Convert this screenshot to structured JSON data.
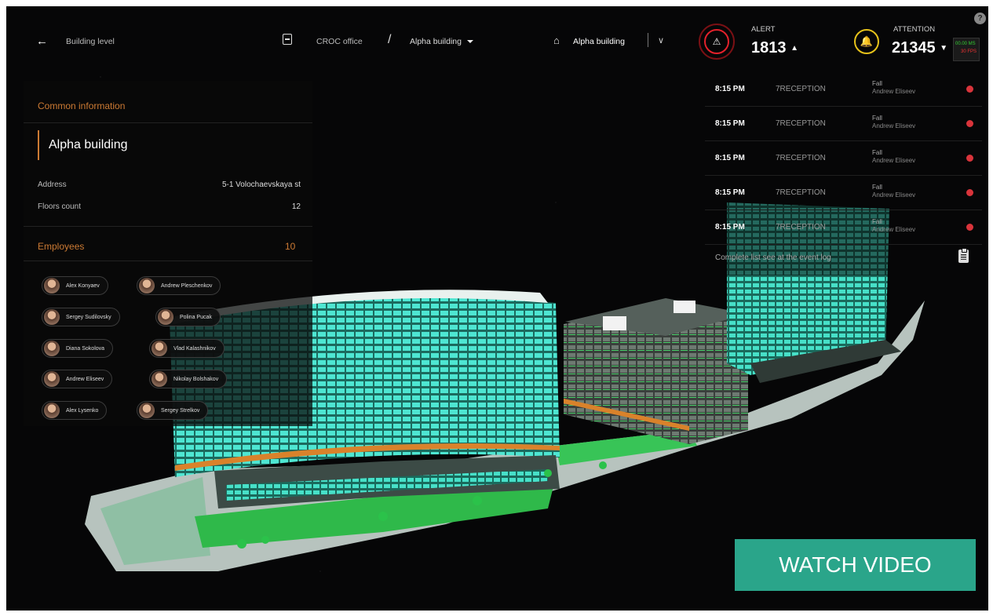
{
  "topbar": {
    "back_label": "Building level",
    "breadcrumb_root": "CROC office",
    "breadcrumb_separator": "/",
    "breadcrumb_current": "Alpha building",
    "building_selector": "Alpha building"
  },
  "counters": {
    "alert_label": "ALERT",
    "alert_value": "1813",
    "attention_label": "ATTENTION",
    "attention_value": "21345",
    "help_label": "?",
    "fps_line1": "00.00 MS",
    "fps_line2": "30 FPS"
  },
  "panel": {
    "section_common": "Common information",
    "building_name": "Alpha building",
    "address_label": "Address",
    "address_value": "5-1 Volochaevskaya st",
    "floors_label": "Floors count",
    "floors_value": "12",
    "employees_label": "Employees",
    "employees_count": "10",
    "employees": [
      "Alex Konyaev",
      "Andrew Pleschenkov",
      "Sergey Sudilovsky",
      "Polina Pucak",
      "Diana Sokolova",
      "Vlad Kalashnikov",
      "Andrew Eliseev",
      "Nikolay Bolshakov",
      "Alex Lysenko",
      "Sergey Strelkov"
    ]
  },
  "events": [
    {
      "time": "8:15 PM",
      "location": "7RECEPTION",
      "type": "Fall",
      "person": "Andrew Eliseev"
    },
    {
      "time": "8:15 PM",
      "location": "7RECEPTION",
      "type": "Fall",
      "person": "Andrew Eliseev"
    },
    {
      "time": "8:15 PM",
      "location": "7RECEPTION",
      "type": "Fall",
      "person": "Andrew Eliseev"
    },
    {
      "time": "8:15 PM",
      "location": "7RECEPTION",
      "type": "Fall",
      "person": "Andrew Eliseev"
    },
    {
      "time": "8:15 PM",
      "location": "7RECEPTION",
      "type": "Fall",
      "person": "Andrew Eliseev"
    }
  ],
  "event_log_note": "Complete list see at the event log",
  "watch_video": "WATCH VIDEO",
  "colors": {
    "accent": "#cc7a33",
    "alert": "#e4212b",
    "attention": "#e6c21a",
    "watch_bg": "#2aa58a",
    "building_glass": "#3fd8c4"
  },
  "icons": {
    "back": "arrow-left-icon",
    "breadcrumb": "collapse-icon",
    "home": "home-icon",
    "alert": "warning-icon",
    "attention": "bell-icon",
    "event_log": "clipboard-icon"
  }
}
